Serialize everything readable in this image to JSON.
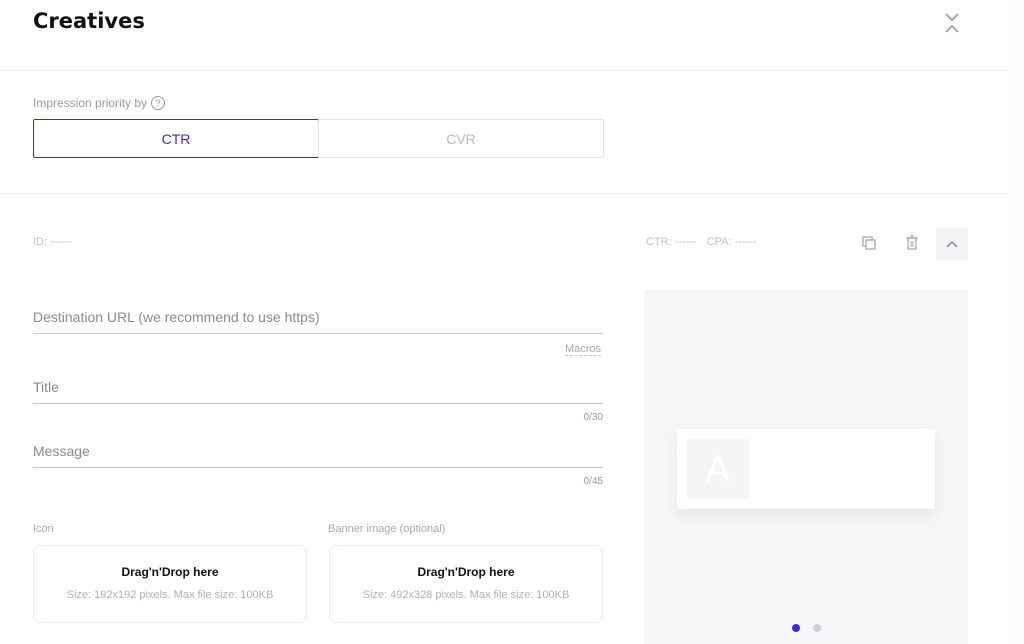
{
  "header": {
    "title": "Creatives"
  },
  "priority": {
    "label": "Impression priority by",
    "options": [
      "CTR",
      "CVR"
    ],
    "selected": "CTR"
  },
  "creative": {
    "id_label": "ID:",
    "id_value": "------",
    "ctr_label": "CTR:",
    "ctr_value": "------",
    "cpa_label": "CPA:",
    "cpa_value": "------"
  },
  "fields": {
    "url_placeholder": "Destination URL (we recommend to use https)",
    "macros_label": "Macros",
    "title_placeholder": "Title",
    "title_counter": "0/30",
    "message_placeholder": "Message",
    "message_counter": "0/45"
  },
  "uploads": {
    "icon": {
      "label": "Icon",
      "title": "Drag'n'Drop here",
      "hint": "Size: 192x192 pixels. Max file size: 100KB"
    },
    "banner": {
      "label": "Banner image (optional)",
      "title": "Drag'n'Drop here",
      "hint": "Size: 492x328 pixels. Max file size: 100KB"
    }
  },
  "preview": {
    "icon_letter": "A",
    "active_slide": 1,
    "slides": 2
  },
  "colors": {
    "accent": "#3a2ad6",
    "muted": "#c2c2ca"
  }
}
